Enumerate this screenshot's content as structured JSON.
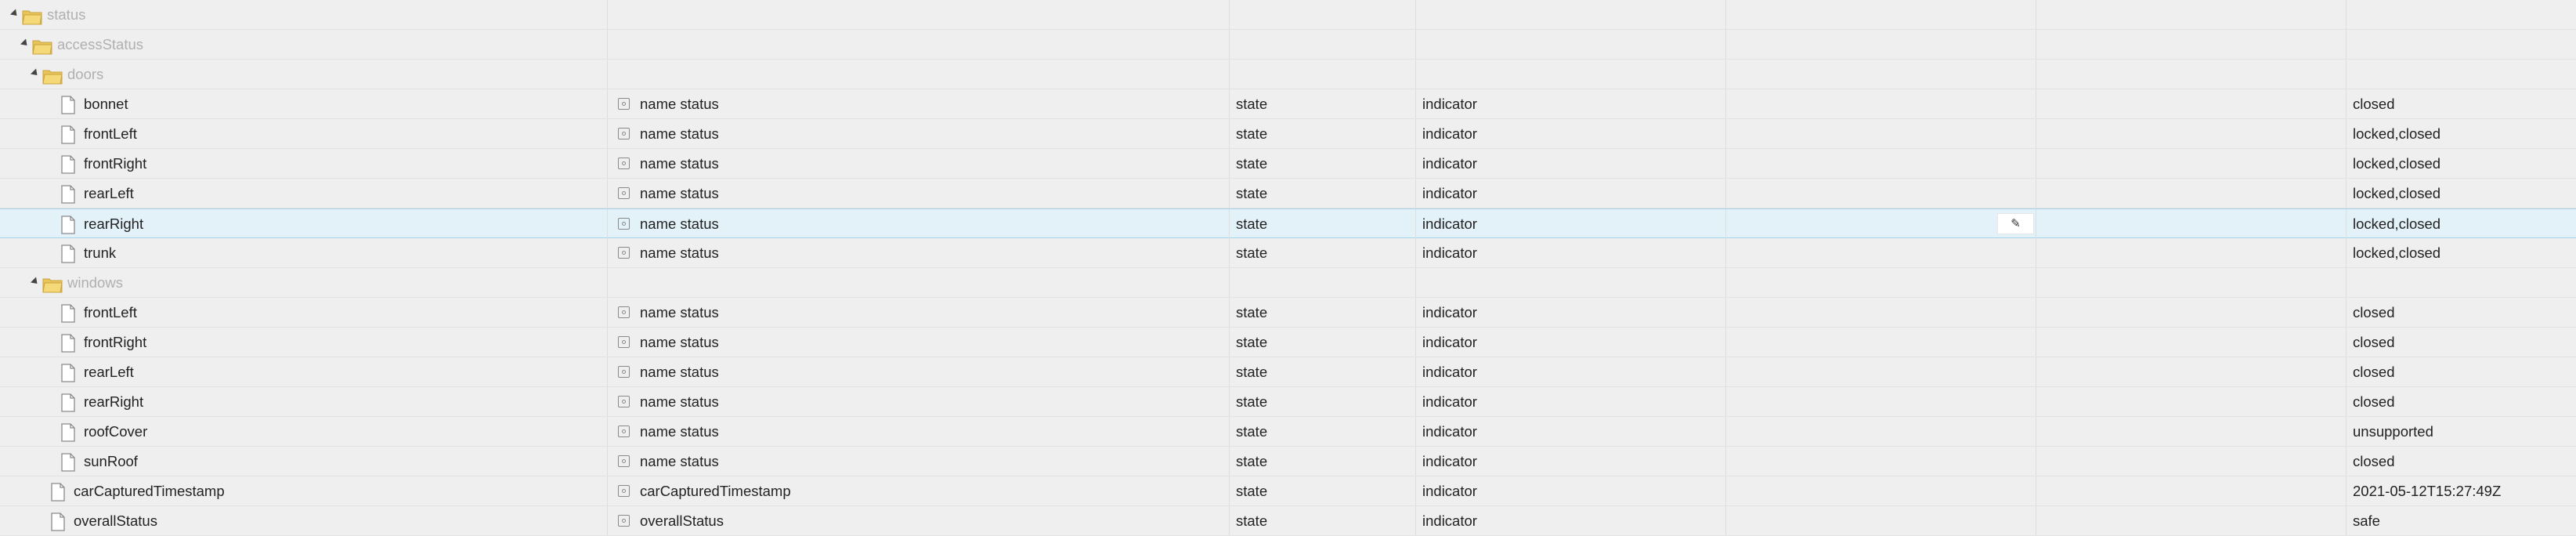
{
  "rows": [
    {
      "type": "folder",
      "level": 0,
      "name": "status",
      "value": ""
    },
    {
      "type": "folder",
      "level": 1,
      "name": "accessStatus",
      "value": ""
    },
    {
      "type": "folder",
      "level": 2,
      "name": "doors",
      "value": ""
    },
    {
      "type": "leaf",
      "level": 3,
      "name": "bonnet",
      "property": "name status",
      "role": "state",
      "type_col": "indicator",
      "value": "closed"
    },
    {
      "type": "leaf",
      "level": 3,
      "name": "frontLeft",
      "property": "name status",
      "role": "state",
      "type_col": "indicator",
      "value": "locked,closed"
    },
    {
      "type": "leaf",
      "level": 3,
      "name": "frontRight",
      "property": "name status",
      "role": "state",
      "type_col": "indicator",
      "value": "locked,closed"
    },
    {
      "type": "leaf",
      "level": 3,
      "name": "rearLeft",
      "property": "name status",
      "role": "state",
      "type_col": "indicator",
      "value": "locked,closed"
    },
    {
      "type": "leaf",
      "level": 3,
      "name": "rearRight",
      "property": "name status",
      "role": "state",
      "type_col": "indicator",
      "value": "locked,closed",
      "selected": true
    },
    {
      "type": "leaf",
      "level": 3,
      "name": "trunk",
      "property": "name status",
      "role": "state",
      "type_col": "indicator",
      "value": "locked,closed"
    },
    {
      "type": "folder",
      "level": 2,
      "name": "windows",
      "value": ""
    },
    {
      "type": "leaf",
      "level": 3,
      "name": "frontLeft",
      "property": "name status",
      "role": "state",
      "type_col": "indicator",
      "value": "closed"
    },
    {
      "type": "leaf",
      "level": 3,
      "name": "frontRight",
      "property": "name status",
      "role": "state",
      "type_col": "indicator",
      "value": "closed"
    },
    {
      "type": "leaf",
      "level": 3,
      "name": "rearLeft",
      "property": "name status",
      "role": "state",
      "type_col": "indicator",
      "value": "closed"
    },
    {
      "type": "leaf",
      "level": 3,
      "name": "rearRight",
      "property": "name status",
      "role": "state",
      "type_col": "indicator",
      "value": "closed"
    },
    {
      "type": "leaf",
      "level": 3,
      "name": "roofCover",
      "property": "name status",
      "role": "state",
      "type_col": "indicator",
      "value": "unsupported"
    },
    {
      "type": "leaf",
      "level": 3,
      "name": "sunRoof",
      "property": "name status",
      "role": "state",
      "type_col": "indicator",
      "value": "closed"
    },
    {
      "type": "leaf",
      "level": 2,
      "name": "carCapturedTimestamp",
      "property": "carCapturedTimestamp",
      "role": "state",
      "type_col": "indicator",
      "value": "2021-05-12T15:27:49Z"
    },
    {
      "type": "leaf",
      "level": 2,
      "name": "overallStatus",
      "property": "overallStatus",
      "role": "state",
      "type_col": "indicator",
      "value": "safe"
    }
  ],
  "edit_icon": "pencil-icon",
  "colors": {
    "background": "#efefef",
    "selected_row": "#e3f1f9",
    "folder_text": "#b0b0b0"
  }
}
